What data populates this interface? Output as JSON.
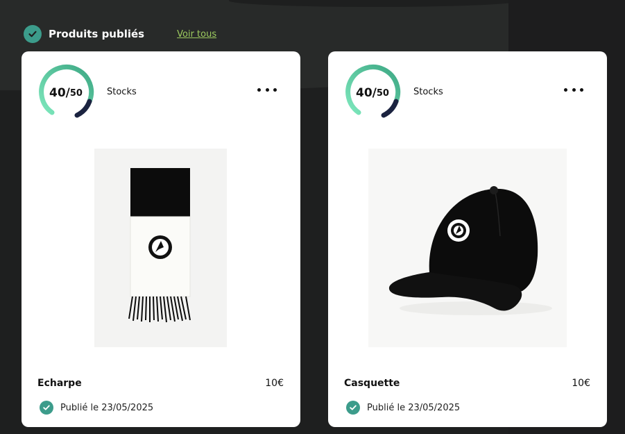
{
  "section": {
    "title": "Produits publiés",
    "see_all": "Voir tous"
  },
  "colors": {
    "accent": "#3c9c8b",
    "link": "#9dcb5f",
    "gauge_start": "#7ee8bd",
    "gauge_end": "#3ca783",
    "gauge_track": "#1b2340"
  },
  "products": [
    {
      "name": "Echarpe",
      "price": "10€",
      "stock_current": "40",
      "stock_max": "50",
      "stock_sep": "/",
      "stock_label": "Stocks",
      "published": "Publié le 23/05/2025",
      "image": "scarf-image"
    },
    {
      "name": "Casquette",
      "price": "10€",
      "stock_current": "40",
      "stock_max": "50",
      "stock_sep": "/",
      "stock_label": "Stocks",
      "published": "Publié le 23/05/2025",
      "image": "cap-image"
    }
  ]
}
